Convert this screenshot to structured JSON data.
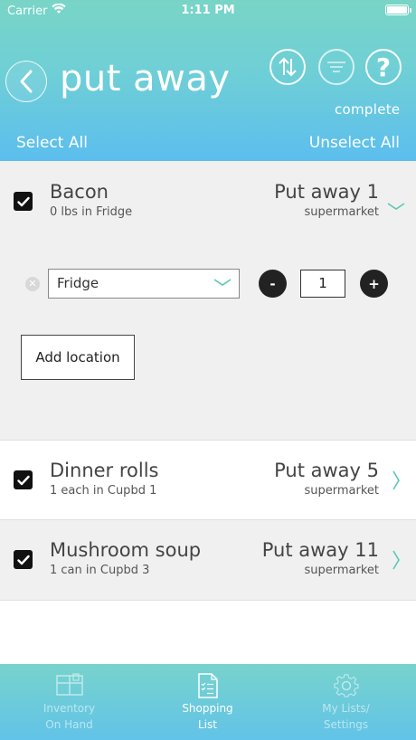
{
  "status_bar": {
    "carrier": "Carrier",
    "time": "1:11 PM"
  },
  "header": {
    "title": "put away",
    "complete_label": "complete",
    "select_all": "Select All",
    "unselect_all": "Unselect All"
  },
  "items": [
    {
      "name": "Bacon",
      "detail": "0 lbs in Fridge",
      "putaway": "Put away 1",
      "store": "supermarket",
      "checked": true,
      "expanded": true,
      "location": {
        "selected": "Fridge",
        "quantity": "1"
      },
      "add_location_label": "Add location",
      "minus_label": "-",
      "plus_label": "+"
    },
    {
      "name": "Dinner rolls",
      "detail": "1 each in Cupbd 1",
      "putaway": "Put away 5",
      "store": "supermarket",
      "checked": true
    },
    {
      "name": "Mushroom soup",
      "detail": "1 can in Cupbd 3",
      "putaway": "Put away 11",
      "store": "supermarket",
      "checked": true
    }
  ],
  "tabbar": {
    "tabs": [
      {
        "label": "Inventory\nOn Hand",
        "icon": "inventory-icon",
        "active": false
      },
      {
        "label": "Shopping\nList",
        "icon": "shopping-list-icon",
        "active": true
      },
      {
        "label": "My Lists/\nSettings",
        "icon": "gear-icon",
        "active": false
      }
    ]
  },
  "colors": {
    "header_top": "#78d5c6",
    "header_bottom": "#5cbeee",
    "accent_chevron": "#5cc6b4",
    "row_grey": "#f0f0f0"
  }
}
